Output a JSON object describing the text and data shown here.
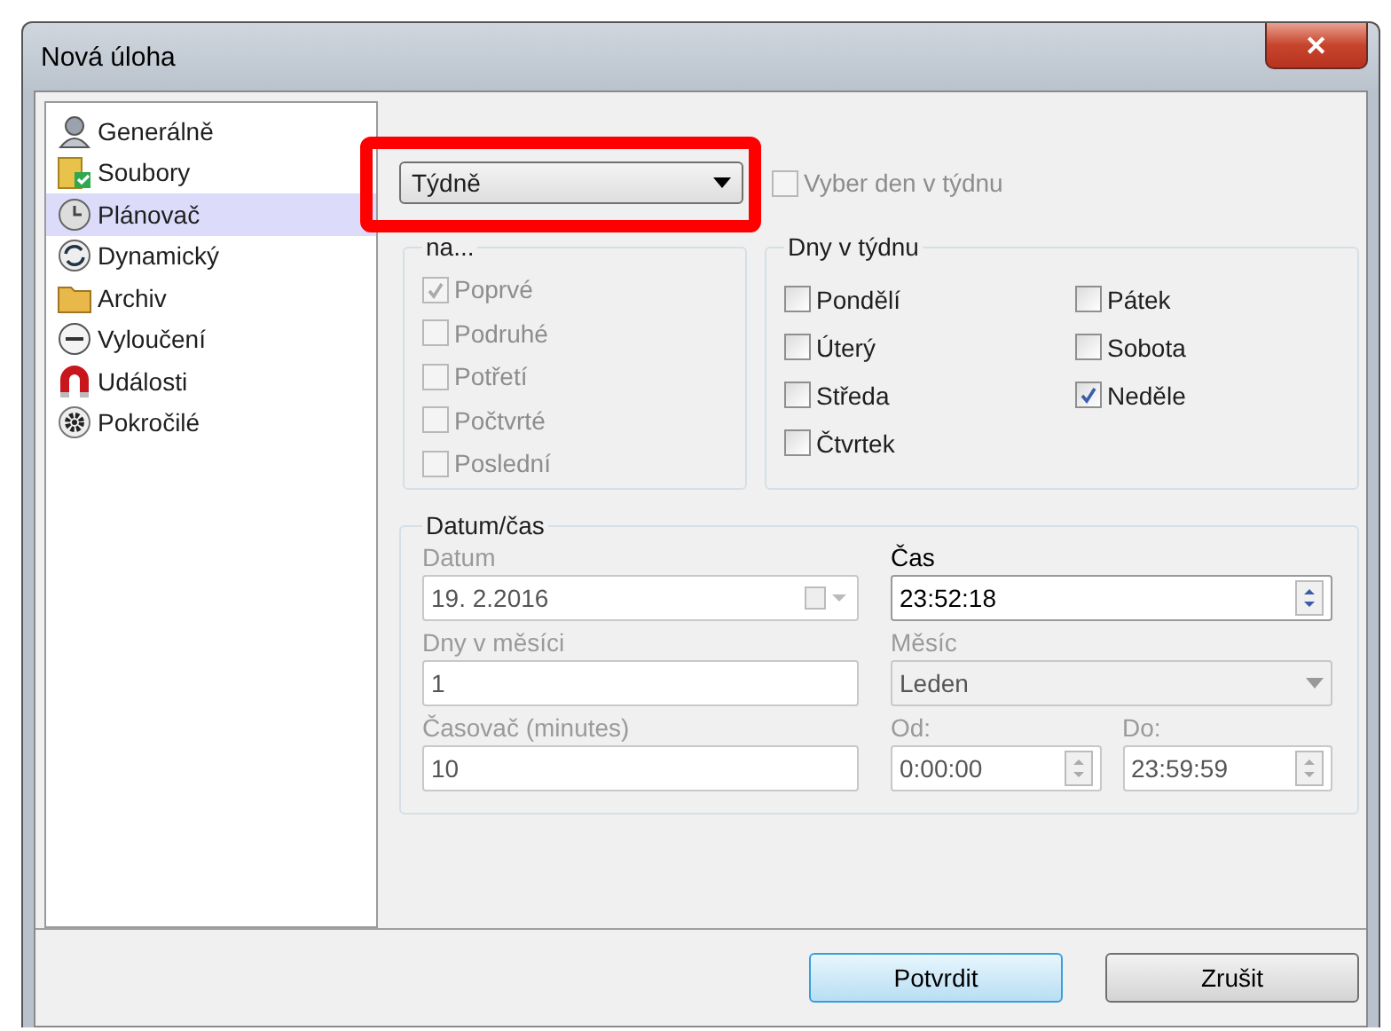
{
  "window": {
    "title": "Nová úloha",
    "close": "✕"
  },
  "sidebar": {
    "items": [
      {
        "label": "Generálně",
        "selected": false
      },
      {
        "label": "Soubory",
        "selected": false
      },
      {
        "label": "Plánovač",
        "selected": true
      },
      {
        "label": "Dynamický",
        "selected": false
      },
      {
        "label": "Archiv",
        "selected": false
      },
      {
        "label": "Vyloučení",
        "selected": false
      },
      {
        "label": "Události",
        "selected": false
      },
      {
        "label": "Pokročilé",
        "selected": false
      }
    ]
  },
  "schedule": {
    "frequency": "Týdně",
    "highlighted": true,
    "pick_weekday": {
      "label": "Vyber den v týdnu",
      "checked": false,
      "disabled": true
    }
  },
  "occurrence": {
    "title": "na...",
    "disabled": true,
    "items": [
      {
        "label": "Poprvé",
        "checked": true
      },
      {
        "label": "Podruhé",
        "checked": false
      },
      {
        "label": "Potřetí",
        "checked": false
      },
      {
        "label": "Počtvrté",
        "checked": false
      },
      {
        "label": "Poslední",
        "checked": false
      }
    ]
  },
  "weekdays": {
    "title": "Dny v týdnu",
    "items": [
      {
        "label": "Pondělí",
        "checked": false
      },
      {
        "label": "Úterý",
        "checked": false
      },
      {
        "label": "Středa",
        "checked": false
      },
      {
        "label": "Čtvrtek",
        "checked": false
      },
      {
        "label": "Pátek",
        "checked": false
      },
      {
        "label": "Sobota",
        "checked": false
      },
      {
        "label": "Neděle",
        "checked": true
      }
    ]
  },
  "datetime": {
    "title": "Datum/čas",
    "date": {
      "label": "Datum",
      "value": "19.  2.2016",
      "disabled": true
    },
    "time": {
      "label": "Čas",
      "value": "23:52:18",
      "disabled": false
    },
    "days_in_month": {
      "label": "Dny v měsíci",
      "value": "1",
      "disabled": true
    },
    "month": {
      "label": "Měsíc",
      "value": "Leden",
      "disabled": true
    },
    "timer": {
      "label": "Časovač (minutes)",
      "value": "10",
      "disabled": true
    },
    "from": {
      "label": "Od:",
      "value": "0:00:00",
      "disabled": true
    },
    "to": {
      "label": "Do:",
      "value": "23:59:59",
      "disabled": true
    }
  },
  "buttons": [
    {
      "label": "Potvrdit",
      "default": true
    },
    {
      "label": "Zrušit",
      "default": false
    }
  ]
}
